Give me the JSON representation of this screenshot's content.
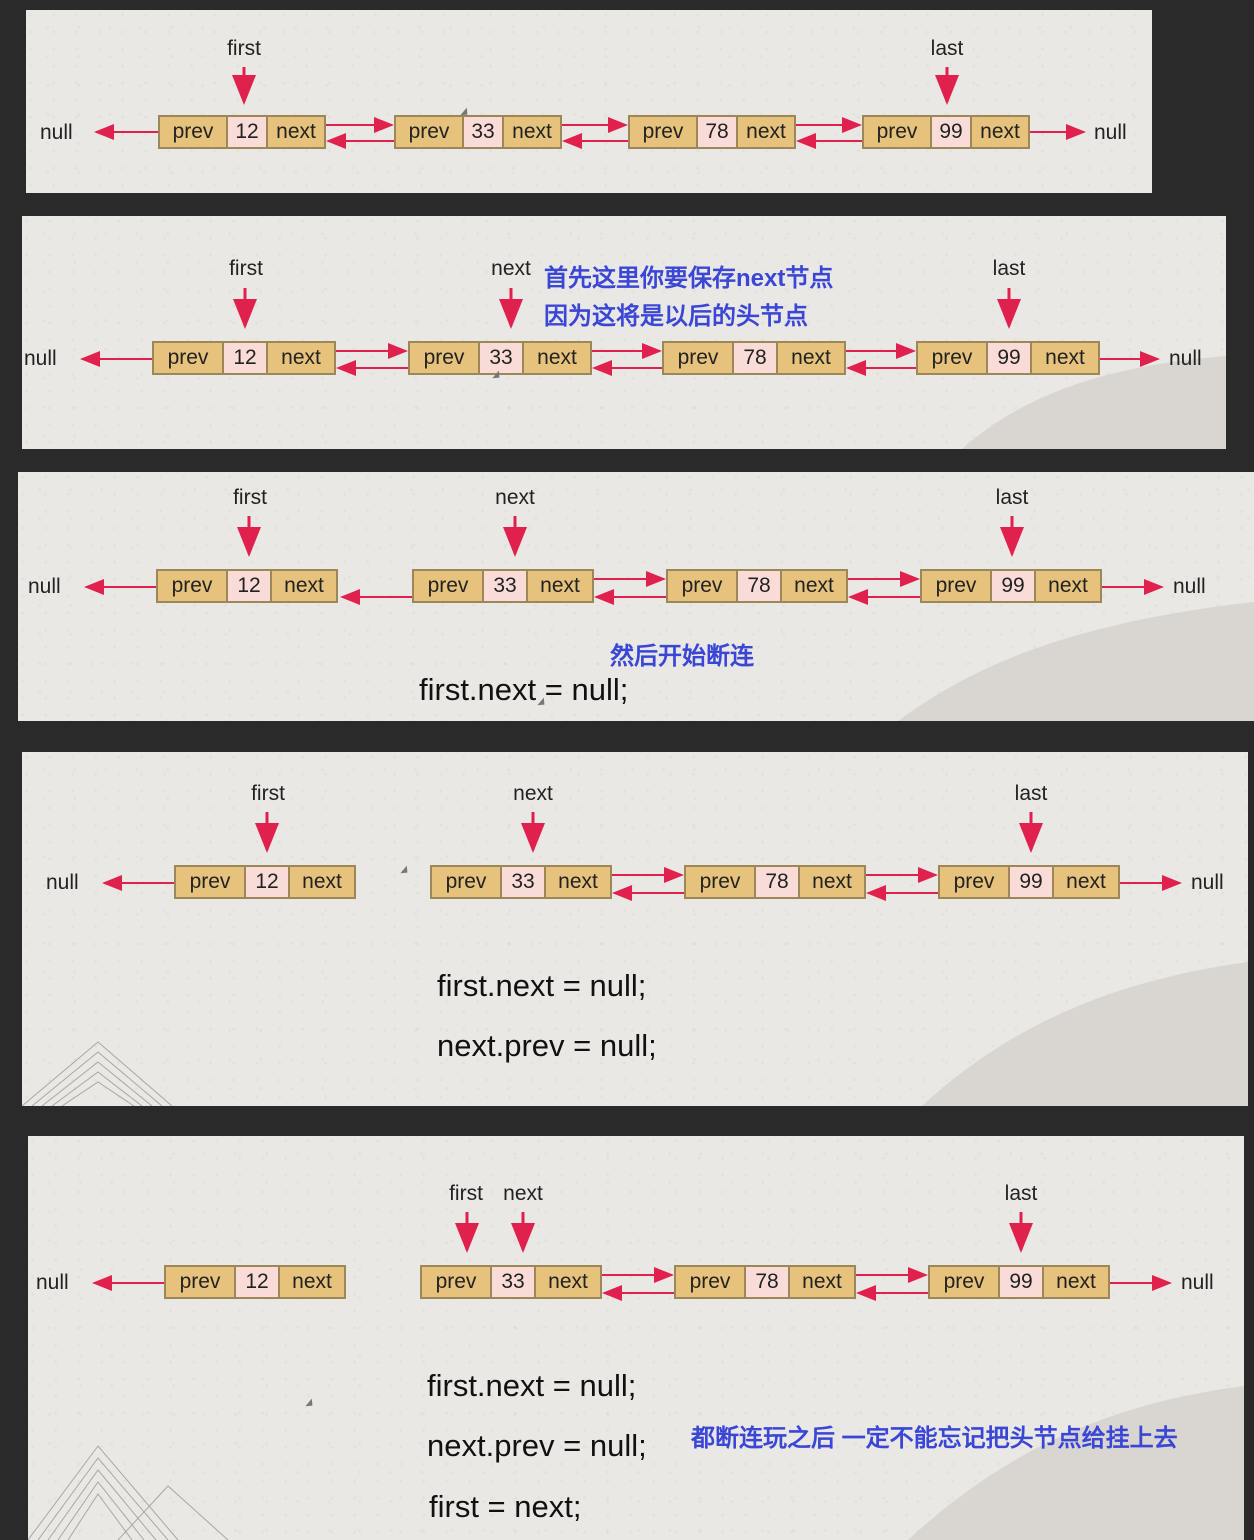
{
  "nodes": {
    "prev_label": "prev",
    "next_label": "next",
    "values": [
      "12",
      "33",
      "78",
      "99"
    ]
  },
  "null_text": "null",
  "pointers": {
    "first": "first",
    "next": "next",
    "last": "last"
  },
  "annotations": {
    "save_next_line1": "首先这里你要保存next节点",
    "save_next_line2": "因为这将是以后的头节点",
    "start_break": "然后开始断连",
    "finally": "都断连玩之后 一定不能忘记把头节点给挂上去"
  },
  "code": {
    "first_next_null": "first.next = null;",
    "next_prev_null": "next.prev = null;",
    "first_eq_next": "first = next;"
  },
  "colors": {
    "node_fill": "#e6c27c",
    "value_fill": "#f9dcd8",
    "arrow": "#e0204d",
    "annotation": "#3a46d6"
  }
}
